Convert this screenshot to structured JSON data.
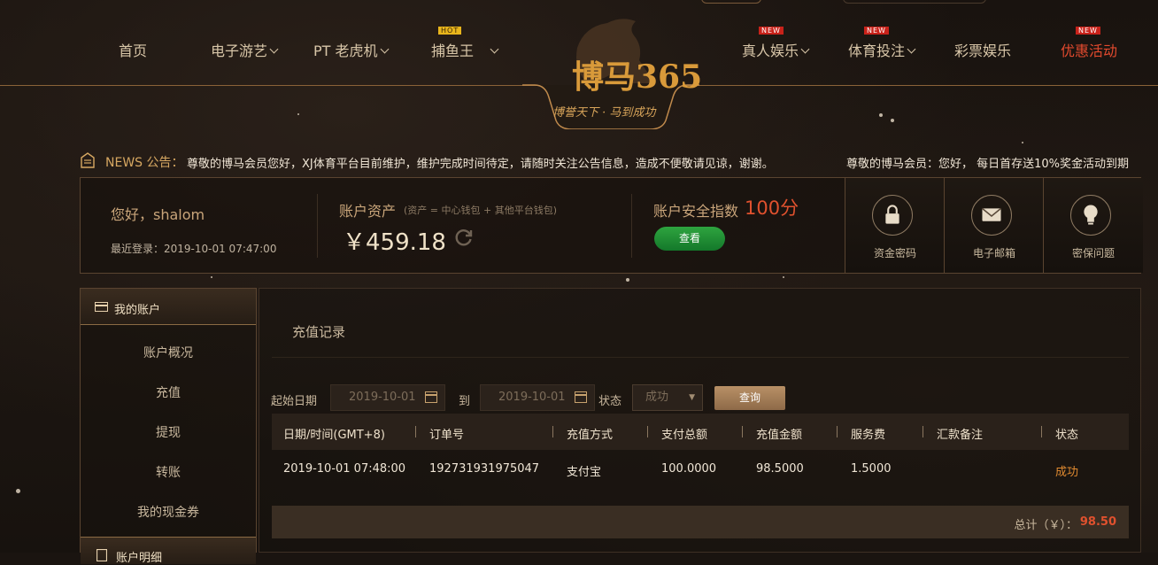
{
  "nav": {
    "items": [
      {
        "label": "首页"
      },
      {
        "label": "电子游艺",
        "dropdown": true
      },
      {
        "label": "PT 老虎机",
        "dropdown": true
      },
      {
        "label": "捕鱼王",
        "badge": "HOT",
        "dropdown": true
      },
      {
        "label": "真人娱乐",
        "badge": "NEW",
        "dropdown": true
      },
      {
        "label": "体育投注",
        "badge": "NEW",
        "dropdown": true
      },
      {
        "label": "彩票娱乐"
      },
      {
        "label": "优惠活动",
        "badge": "NEW",
        "highlight": true
      }
    ],
    "logo_text": "博马365",
    "logo_slogan": "博誉天下 · 马到成功"
  },
  "notice": {
    "label": "NEWS 公告：",
    "messages": [
      "尊敬的博马会员您好，XJ体育平台目前维护，维护完成时间待定，请随时关注公告信息，造成不便敬请见谅，谢谢。",
      "尊敬的博马会员：您好，  每日首存送10%奖金活动到期"
    ]
  },
  "account_info": {
    "greeting": "您好，shalom",
    "last_login": "最近登录：2019-10-01 07:47:00",
    "asset_title": "账户资产",
    "asset_sub": "(资产 = 中心钱包 + 其他平台钱包)",
    "asset_amount": "￥459.18",
    "security_title": "账户安全指数",
    "security_score": "100分",
    "check_button": "查看",
    "quick_links": [
      {
        "label": "资金密码",
        "icon": "lock-icon"
      },
      {
        "label": "电子邮箱",
        "icon": "mail-icon"
      },
      {
        "label": "密保问题",
        "icon": "lightbulb-icon"
      }
    ]
  },
  "sidebar": {
    "header": "我的账户",
    "items": [
      {
        "label": "账户概况"
      },
      {
        "label": "充值"
      },
      {
        "label": "提现"
      },
      {
        "label": "转账"
      },
      {
        "label": "我的现金券"
      }
    ],
    "header2": "账户明细"
  },
  "main": {
    "title": "充值记录",
    "filter": {
      "start_label": "起始日期",
      "start_date": "2019-10-01",
      "to_label": "到",
      "end_date": "2019-10-01",
      "status_label": "状态",
      "status_value": "成功",
      "query_button": "查询"
    },
    "table": {
      "headers": [
        "日期/时间(GMT+8)",
        "订单号",
        "充值方式",
        "支付总额",
        "充值金额",
        "服务费",
        "汇款备注",
        "状态"
      ],
      "rows": [
        [
          "2019-10-01 07:48:00",
          "192731931975047",
          "支付宝",
          "100.0000",
          "98.5000",
          "1.5000",
          "",
          "成功"
        ]
      ]
    },
    "total_label": "总计（￥）：",
    "total_value": "98.50"
  },
  "colors": {
    "accent_gold": "#c9a57a",
    "highlight_red": "#e0512e",
    "status_orange": "#e08a30",
    "button_green": "#2ea43f"
  }
}
